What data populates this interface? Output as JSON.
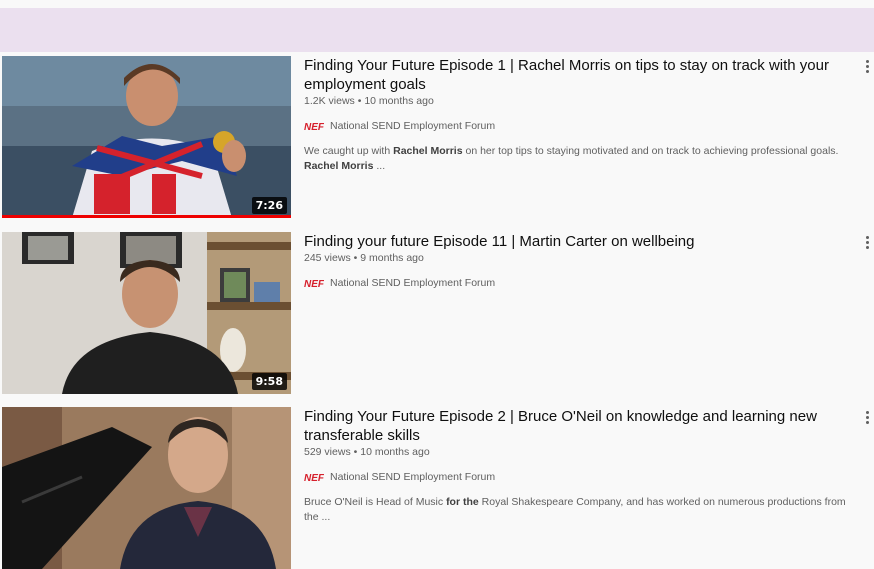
{
  "channel_name": "National SEND Employment Forum",
  "channel_logo_text": "NEF",
  "stats_separator": "•",
  "videos": [
    {
      "title": "Finding Your Future Episode 1 | Rachel Morris on tips to stay on track with your employment goals",
      "views": "1.2K views",
      "age": "10 months ago",
      "duration": "7:26",
      "watch_progress": 1.0,
      "description": {
        "p1": "We caught up with ",
        "b1": "Rachel Morris",
        "p2": " on her top tips to staying motivated and on track to achieving professional goals. ",
        "b2": "Rachel Morris",
        "p3": " ..."
      }
    },
    {
      "title": "Finding your future Episode 11 | Martin Carter on wellbeing",
      "views": "245 views",
      "age": "9 months ago",
      "duration": "9:58"
    },
    {
      "title": "Finding Your Future Episode 2 | Bruce O'Neil on knowledge and learning new transferable skills",
      "views": "529 views",
      "age": "10 months ago",
      "description": {
        "p1": "Bruce O'Neil is Head of Music ",
        "b1": "for the",
        "p2": " Royal Shakespeare Company, and has worked on numerous productions from the ..."
      }
    }
  ],
  "colors": {
    "topbar": "#ebe0ef",
    "progress": "#ee0000",
    "logo_red": "#d6202c"
  }
}
